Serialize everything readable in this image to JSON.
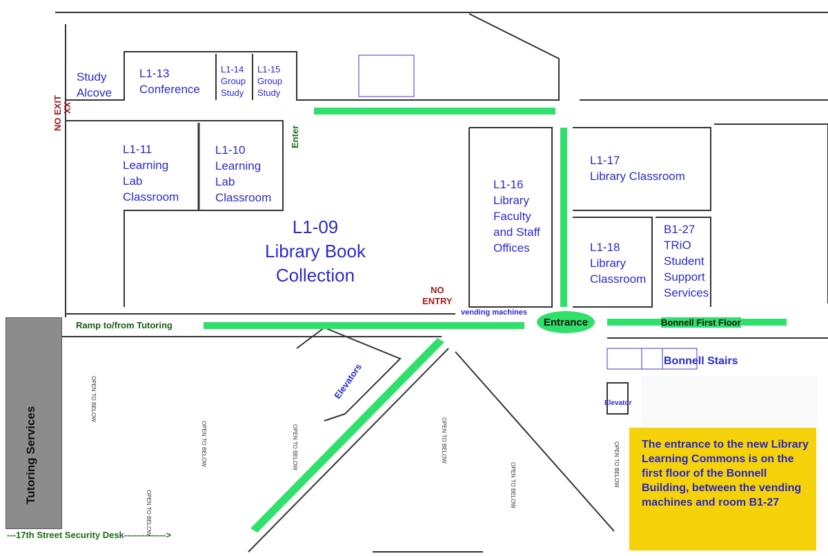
{
  "rooms": {
    "study_alcove": "Study\nAlcove",
    "l1_13": "L1-13\nConference",
    "l1_14": "L1-14\nGroup\nStudy",
    "l1_15": "L1-15\nGroup\nStudy",
    "l1_11": "L1-11\nLearning\nLab\nClassroom",
    "l1_10": "L1-10\nLearning\nLab\nClassroom",
    "l1_09": "L1-09\nLibrary Book\nCollection",
    "l1_16": "L1-16\nLibrary\nFaculty\nand Staff\nOffices",
    "l1_17": "L1-17\nLibrary Classroom",
    "l1_18": "L1-18\nLibrary\nClassroom",
    "b1_27": "B1-27\nTRiO\nStudent\nSupport\nServices"
  },
  "signs": {
    "no_exit": "NO EXIT",
    "xx": "XX",
    "enter": "Enter",
    "no_entry": "NO\nENTRY",
    "vending": "vending machines",
    "entrance": "Entrance",
    "elevators": "Elevators",
    "elevator": "Elevator",
    "bonnell_stairs": "Bonnell Stairs",
    "open_to_below": "OPEN TO BELOW"
  },
  "paths": {
    "ramp": "Ramp to/from Tutoring",
    "bonnell_first_floor": "Bonnell First Floor",
    "security_desk": "---17th Street Security Desk-------------->"
  },
  "tutoring": "Tutoring Services",
  "note": "The entrance to the new Library Learning Commons is on the first floor of the Bonnell Building, between the vending machines and room B1-27",
  "colors": {
    "path": "#2fe06a",
    "room_text": "#2a2ad0",
    "note_bg": "#f5d20a",
    "warning": "#9b1c1c"
  }
}
